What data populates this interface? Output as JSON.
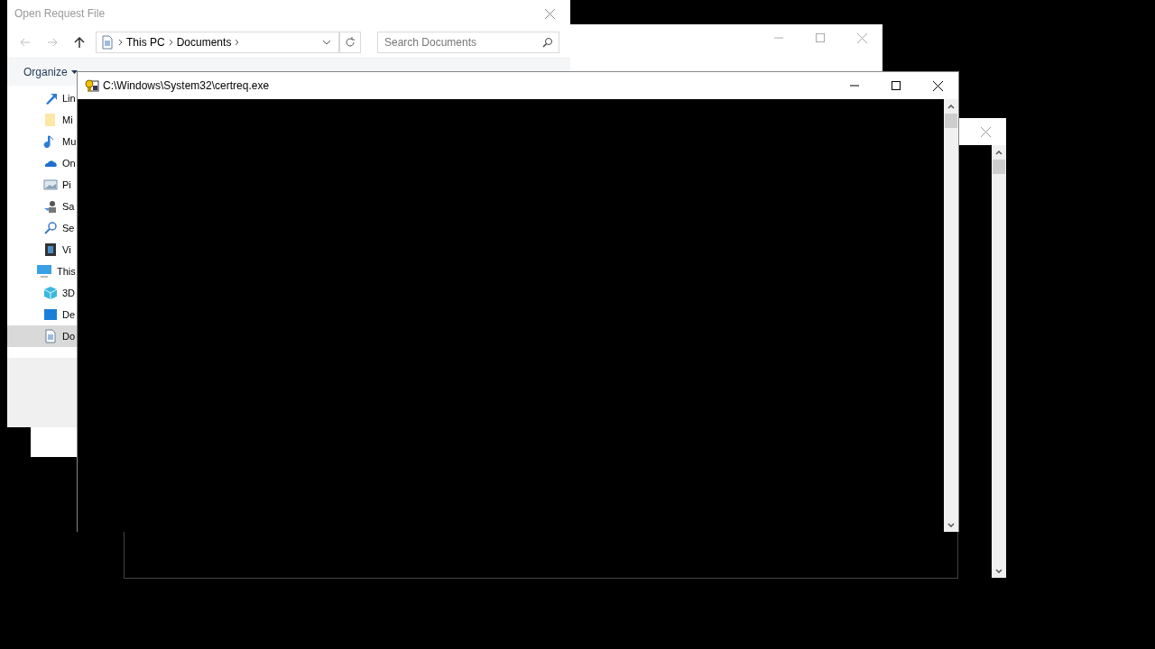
{
  "dialog": {
    "title": "Open Request File",
    "breadcrumb": [
      "This PC",
      "Documents"
    ],
    "search": {
      "placeholder": "Search Documents"
    },
    "toolbar": {
      "organize": "Organize"
    },
    "sidebar": {
      "items": [
        {
          "label": "Lin",
          "selected": false
        },
        {
          "label": "Mi",
          "selected": false
        },
        {
          "label": "Mu",
          "selected": false
        },
        {
          "label": "On",
          "selected": false
        },
        {
          "label": "Pi",
          "selected": false
        },
        {
          "label": "Sa",
          "selected": false
        },
        {
          "label": "Se",
          "selected": false
        },
        {
          "label": "Vi",
          "selected": false
        },
        {
          "label": "This",
          "selected": false,
          "children": [
            {
              "label": "3D",
              "selected": false
            },
            {
              "label": "De",
              "selected": false
            },
            {
              "label": "Do",
              "selected": true
            }
          ]
        }
      ]
    }
  },
  "console": {
    "title": "C:\\Windows\\System32\\certreq.exe"
  }
}
